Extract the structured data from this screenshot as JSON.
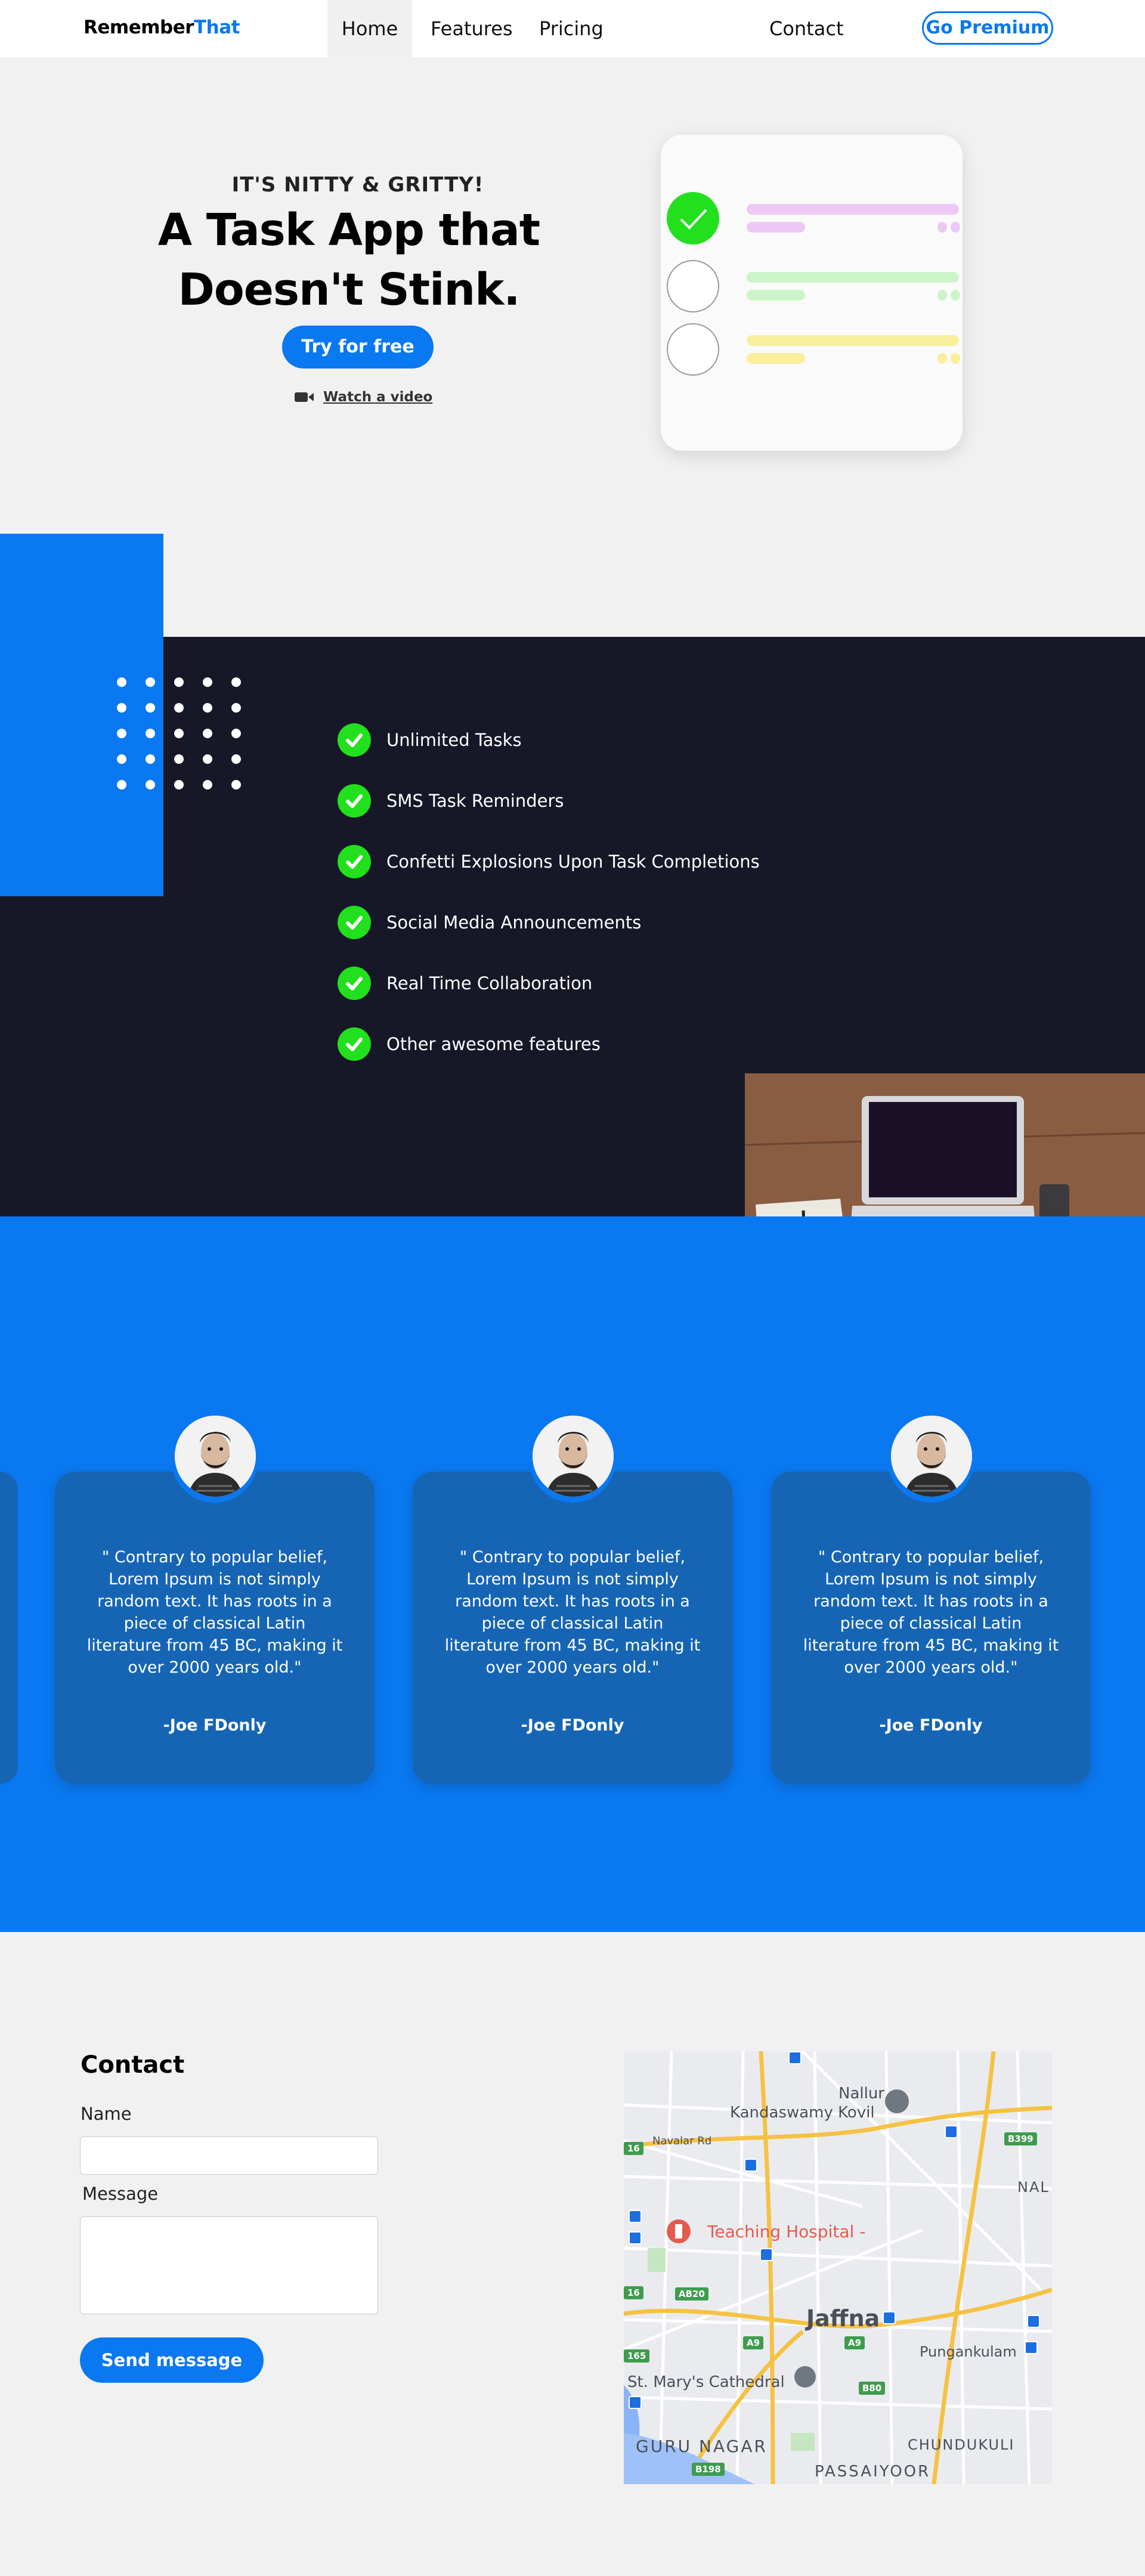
{
  "nav": {
    "logo_part1": "Remember",
    "logo_part2": "That",
    "home": "Home",
    "features": "Features",
    "pricing": "Pricing",
    "contact": "Contact",
    "premium": "Go Premium"
  },
  "hero": {
    "eyebrow": "IT'S NITTY & GRITTY!",
    "title": "A Task App that Doesn't Stink.",
    "cta": "Try for free",
    "video_link": "Watch a video"
  },
  "features": [
    "Unlimited Tasks",
    "SMS Task Reminders",
    "Confetti Explosions Upon Task Completions",
    "Social Media Announcements",
    "Real Time Collaboration",
    "Other awesome features"
  ],
  "testimonials": [
    {
      "quote": "\" Contrary to popular belief, Lorem Ipsum is not simply random text. It has roots in a piece of classical Latin literature from 45 BC, making it over 2000 years old.\"",
      "author": "-Joe FDonly"
    },
    {
      "quote": "\" Contrary to popular belief, Lorem Ipsum is not simply random text. It has roots in a piece of classical Latin literature from 45 BC, making it over 2000 years old.\"",
      "author": "-Joe FDonly"
    },
    {
      "quote": "\" Contrary to popular belief, Lorem Ipsum is not simply random text. It has roots in a piece of classical Latin literature from 45 BC, making it over 2000 years old.\"",
      "author": "-Joe FDonly"
    }
  ],
  "contact": {
    "title": "Contact",
    "name_label": "Name",
    "message_label": "Message",
    "send": "Send message",
    "name_value": "",
    "message_value": ""
  },
  "map": {
    "nallur": "Nallur",
    "kandaswamy": "Kandaswamy Kovil",
    "navalar": "Navalar Rd",
    "teaching": "Teaching Hospital -",
    "jaffna": "Jaffna",
    "pungankulam": "Pungankulam",
    "st_marys": "St. Mary's Cathedral",
    "guru_nagar": "GURU NAGAR",
    "chundukuli": "CHUNDUKULI",
    "passaiyoor": "PASSAIYOOR",
    "nal": "NAL",
    "b399": "B399",
    "ab20": "AB20",
    "a9_1": "A9",
    "a9_2": "A9",
    "b80": "B80",
    "b198": "B198",
    "n16a": "16",
    "n16b": "16",
    "n165": "165"
  },
  "colors": {
    "brand_blue": "#0a78f0",
    "dark_bg": "#161828",
    "check_green": "#22e01d",
    "card_blue": "#1665b5"
  }
}
